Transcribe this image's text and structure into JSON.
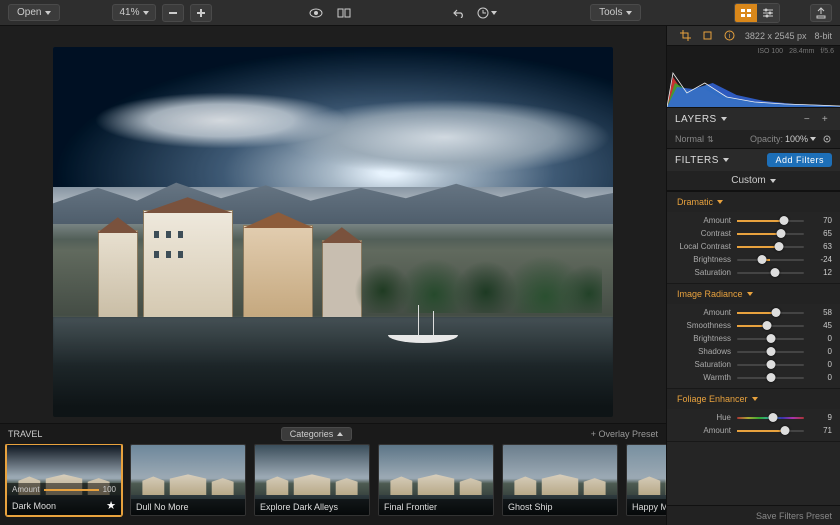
{
  "toolbar": {
    "open": "Open",
    "zoom": "41%",
    "tools": "Tools"
  },
  "meta": {
    "dimensions": "3822 x 2545 px",
    "depth": "8-bit",
    "iso": "ISO 100",
    "focal": "28.4mm",
    "aperture": "f/5.6"
  },
  "layers": {
    "title": "LAYERS",
    "blend_label": "Normal",
    "opacity_label": "Opacity:",
    "opacity_value": "100%"
  },
  "filters": {
    "title": "FILTERS",
    "add_button": "Add Filters",
    "preset": "Custom",
    "groups": [
      {
        "name": "Dramatic",
        "sliders": [
          {
            "label": "Amount",
            "value": 70,
            "pct": 70,
            "center": false
          },
          {
            "label": "Contrast",
            "value": 65,
            "pct": 65,
            "center": false
          },
          {
            "label": "Local Contrast",
            "value": 63,
            "pct": 63,
            "center": false
          },
          {
            "label": "Brightness",
            "value": -24,
            "pct": 38,
            "center": true,
            "neg": true
          },
          {
            "label": "Saturation",
            "value": 12,
            "pct": 56,
            "center": true
          }
        ]
      },
      {
        "name": "Image Radiance",
        "sliders": [
          {
            "label": "Amount",
            "value": 58,
            "pct": 58,
            "center": false
          },
          {
            "label": "Smoothness",
            "value": 45,
            "pct": 45,
            "center": false
          },
          {
            "label": "Brightness",
            "value": 0,
            "pct": 50,
            "center": true
          },
          {
            "label": "Shadows",
            "value": 0,
            "pct": 50,
            "center": true
          },
          {
            "label": "Saturation",
            "value": 0,
            "pct": 50,
            "center": true
          },
          {
            "label": "Warmth",
            "value": 0,
            "pct": 50,
            "center": true
          }
        ]
      },
      {
        "name": "Foliage Enhancer",
        "sliders": [
          {
            "label": "Hue",
            "value": 9,
            "pct": 54,
            "center": true,
            "grad": true
          },
          {
            "label": "Amount",
            "value": 71,
            "pct": 71,
            "center": false
          }
        ]
      }
    ],
    "save": "Save Filters Preset"
  },
  "strip": {
    "group": "TRAVEL",
    "categories": "Categories",
    "overlay": "+ Overlay Preset",
    "amount_label": "Amount",
    "amount_value": "100",
    "items": [
      {
        "name": "Dark Moon",
        "selected": true,
        "fav": true,
        "tone": "#0e1620"
      },
      {
        "name": "Dull No More",
        "tone": "#6d879b"
      },
      {
        "name": "Explore Dark Alleys",
        "tone": "#3b4e5b"
      },
      {
        "name": "Final Frontier",
        "tone": "#5c7587"
      },
      {
        "name": "Ghost Ship",
        "tone": "#6b7e8d"
      },
      {
        "name": "Happy Memories",
        "tone": "#7890a0"
      }
    ]
  }
}
